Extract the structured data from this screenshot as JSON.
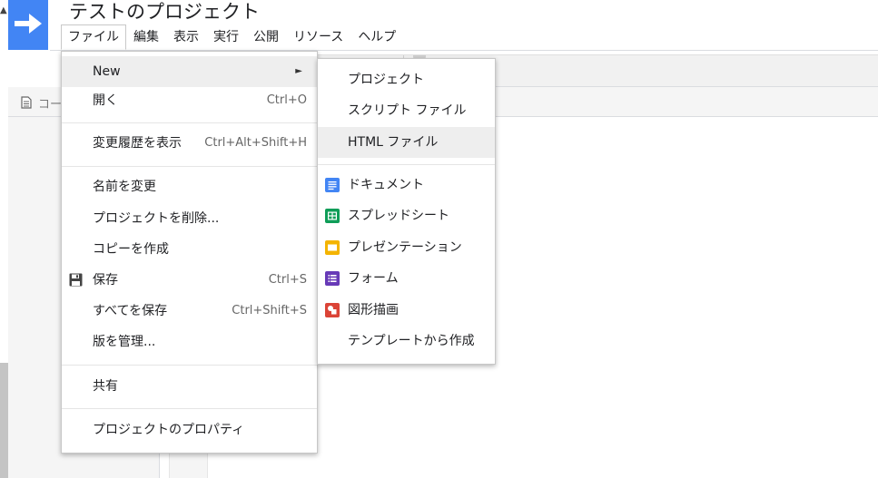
{
  "app": {
    "project_title": "テストのプロジェクト"
  },
  "menubar": [
    {
      "label": "ファイル"
    },
    {
      "label": "編集"
    },
    {
      "label": "表示"
    },
    {
      "label": "実行"
    },
    {
      "label": "公開"
    },
    {
      "label": "リソース"
    },
    {
      "label": "ヘルプ"
    }
  ],
  "filebar": {
    "label": "コー"
  },
  "file_menu": {
    "new": {
      "label": "New",
      "arrow": "►"
    },
    "open": {
      "label": "開く",
      "shortcut": "Ctrl+O"
    },
    "history": {
      "label": "変更履歴を表示",
      "shortcut": "Ctrl+Alt+Shift+H"
    },
    "rename": {
      "label": "名前を変更"
    },
    "delete": {
      "label": "プロジェクトを削除..."
    },
    "copy": {
      "label": "コピーを作成"
    },
    "save": {
      "label": "保存",
      "shortcut": "Ctrl+S",
      "icon": "save-icon"
    },
    "save_all": {
      "label": "すべてを保存",
      "shortcut": "Ctrl+Shift+S"
    },
    "versions": {
      "label": "版を管理..."
    },
    "share": {
      "label": "共有"
    },
    "properties": {
      "label": "プロジェクトのプロパティ"
    }
  },
  "new_submenu": {
    "project": {
      "label": "プロジェクト"
    },
    "script_file": {
      "label": "スクリプト ファイル"
    },
    "html_file": {
      "label": "HTML ファイル"
    },
    "document": {
      "label": "ドキュメント",
      "icon": "docs-icon",
      "color": "#4285f4"
    },
    "spreadsheet": {
      "label": "スプレッドシート",
      "icon": "sheets-icon",
      "color": "#0f9d58"
    },
    "presentation": {
      "label": "プレゼンテーション",
      "icon": "slides-icon",
      "color": "#f4b400"
    },
    "form": {
      "label": "フォーム",
      "icon": "forms-icon",
      "color": "#673ab7"
    },
    "drawing": {
      "label": "図形描画",
      "icon": "drawings-icon",
      "color": "#db4437"
    },
    "template": {
      "label": "テンプレートから作成"
    }
  },
  "colors": {
    "brand": "#4285f4",
    "highlight": "#eeeeee"
  }
}
